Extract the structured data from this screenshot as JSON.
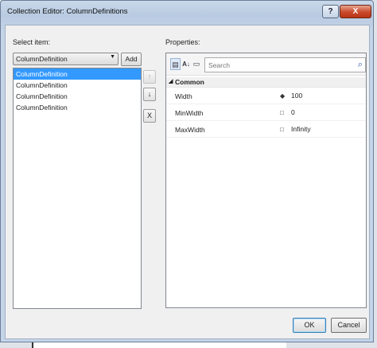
{
  "window": {
    "title": "Collection Editor: ColumnDefinitions",
    "help_label": "?",
    "close_label": "X"
  },
  "left": {
    "select_label": "Select item:",
    "type_combo_value": "ColumnDefinition",
    "add_label": "Add",
    "items": [
      "ColumnDefinition",
      "ColumnDefinition",
      "ColumnDefinition",
      "ColumnDefinition"
    ],
    "selected_index": 0,
    "move_up_glyph": "↑",
    "move_down_glyph": "↓",
    "remove_glyph": "X"
  },
  "right": {
    "properties_label": "Properties:",
    "search_placeholder": "Search",
    "category": "Common",
    "rows": [
      {
        "name": "Width",
        "value": "100",
        "marker": "◆"
      },
      {
        "name": "MinWidth",
        "value": "0",
        "marker": "□"
      },
      {
        "name": "MaxWidth",
        "value": "Infinity",
        "marker": "□"
      }
    ]
  },
  "buttons": {
    "ok": "OK",
    "cancel": "Cancel"
  }
}
